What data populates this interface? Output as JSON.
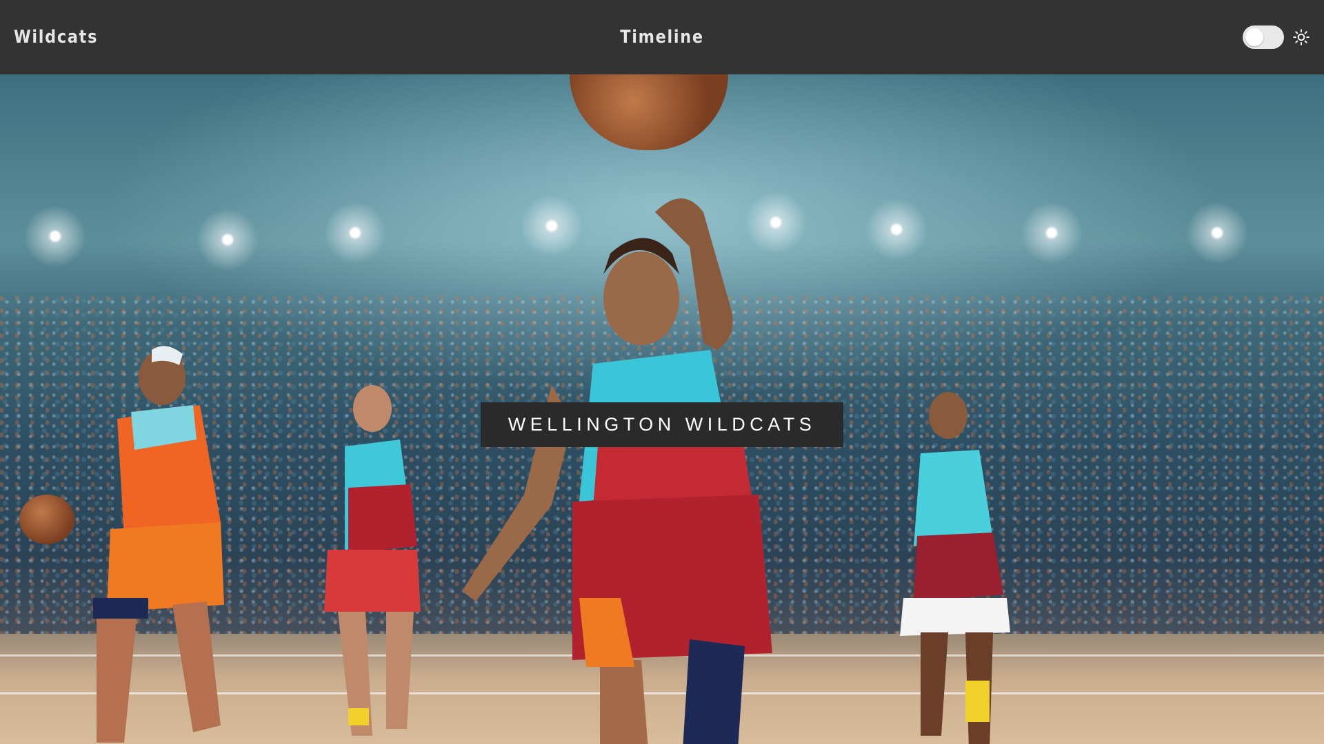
{
  "header": {
    "brand": "Wildcats",
    "nav_title": "Timeline",
    "theme_toggle_state": "off",
    "theme_icon": "sun-icon"
  },
  "hero": {
    "title": "WELLINGTON WILDCATS",
    "image_subject": "hero-background-image"
  },
  "colors": {
    "header_bg": "#333333",
    "header_text": "#e6e6e6",
    "title_box_bg": "#2a2a2a",
    "title_text": "#ffffff",
    "jersey_teal": "#3ec8d8",
    "jersey_red": "#b2222e",
    "jersey_orange": "#f07a22"
  }
}
